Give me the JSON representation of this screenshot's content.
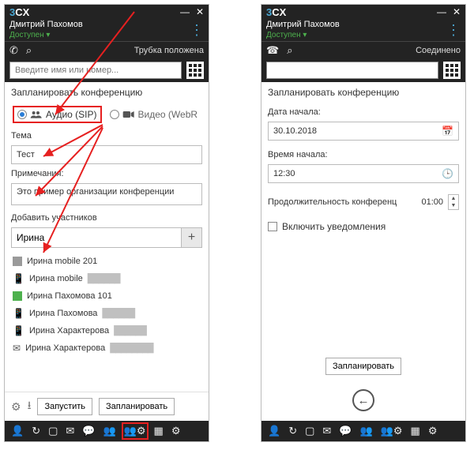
{
  "left": {
    "logo_three": "3",
    "logo_cx": "CX",
    "user_name": "Дмитрий Пахомов",
    "user_status": "Доступен ▾",
    "hook_status": "Трубка положена",
    "search_placeholder": "Введите имя или номер...",
    "title": "Запланировать конференцию",
    "audio_label": "Аудио (SIP)",
    "video_label": "Видео (WebR",
    "subject_label": "Тема",
    "subject_value": "Тест",
    "notes_label": "Примечания:",
    "notes_value": "Это пример организации конференции",
    "add_label": "Добавить участников",
    "add_value": "Ирина",
    "plus": "+",
    "list": [
      {
        "kind": "sq",
        "name": "Ирина mobile 201",
        "extra": ""
      },
      {
        "kind": "ph",
        "name": "Ирина mobile",
        "extra": "██████"
      },
      {
        "kind": "sqg",
        "name": "Ирина Пахомова 101",
        "extra": ""
      },
      {
        "kind": "ph",
        "name": "Ирина Пахомова",
        "extra": "██████"
      },
      {
        "kind": "ph",
        "name": "Ирина Характерова",
        "extra": "██████"
      },
      {
        "kind": "mail",
        "name": "Ирина Характерова",
        "extra": "████████"
      }
    ],
    "btn_start": "Запустить",
    "btn_schedule": "Запланировать"
  },
  "right": {
    "logo_three": "3",
    "logo_cx": "CX",
    "user_name": "Дмитрий Пахомов",
    "user_status": "Доступен ▾",
    "hook_status": "Соединено",
    "title": "Запланировать конференцию",
    "date_label": "Дата начала:",
    "date_value": "30.10.2018",
    "time_label": "Время начала:",
    "time_value": "12:30",
    "dur_label": "Продолжительность конференц",
    "dur_value": "01:00",
    "notify_label": "Включить уведомления",
    "btn_schedule": "Запланировать",
    "back": "←"
  }
}
